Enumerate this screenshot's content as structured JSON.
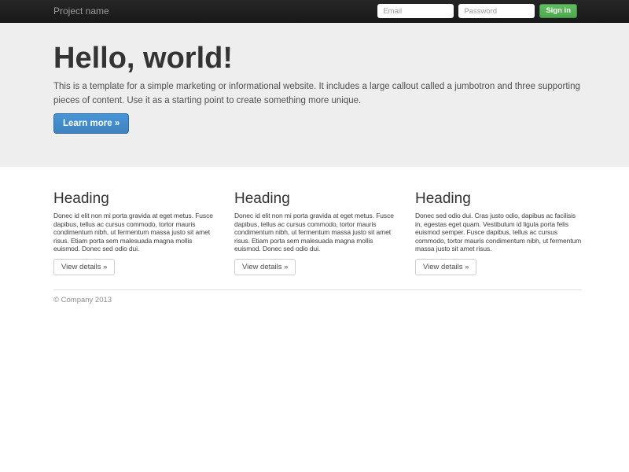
{
  "navbar": {
    "brand": "Project name",
    "form": {
      "email_placeholder": "Email",
      "password_placeholder": "Password",
      "signin_label": "Sign in"
    }
  },
  "jumbotron": {
    "title": "Hello, world!",
    "description": "This is a template for a simple marketing or informational website. It includes a large callout called a jumbotron and three supporting pieces of content. Use it as a starting point to create something more unique.",
    "cta_label": "Learn more »"
  },
  "columns": [
    {
      "heading": "Heading",
      "body": "Donec id elit non mi porta gravida at eget metus. Fusce dapibus, tellus ac cursus commodo, tortor mauris condimentum nibh, ut fermentum massa justo sit amet risus. Etiam porta sem malesuada magna mollis euismod. Donec sed odio dui.",
      "button_label": "View details »"
    },
    {
      "heading": "Heading",
      "body": "Donec id elit non mi porta gravida at eget metus. Fusce dapibus, tellus ac cursus commodo, tortor mauris condimentum nibh, ut fermentum massa justo sit amet risus. Etiam porta sem malesuada magna mollis euismod. Donec sed odio dui.",
      "button_label": "View details »"
    },
    {
      "heading": "Heading",
      "body": "Donec sed odio dui. Cras justo odio, dapibus ac facilisis in, egestas eget quam. Vestibulum id ligula porta felis euismod semper. Fusce dapibus, tellus ac cursus commodo, tortor mauris condimentum nibh, ut fermentum massa justo sit amet risus.",
      "button_label": "View details »"
    }
  ],
  "footer": {
    "copyright": "© Company 2013"
  },
  "colors": {
    "navbar_bg": "#222222",
    "jumbotron_bg": "#eeeeee",
    "primary_button": "#428bca",
    "success_button": "#5cb85c"
  }
}
